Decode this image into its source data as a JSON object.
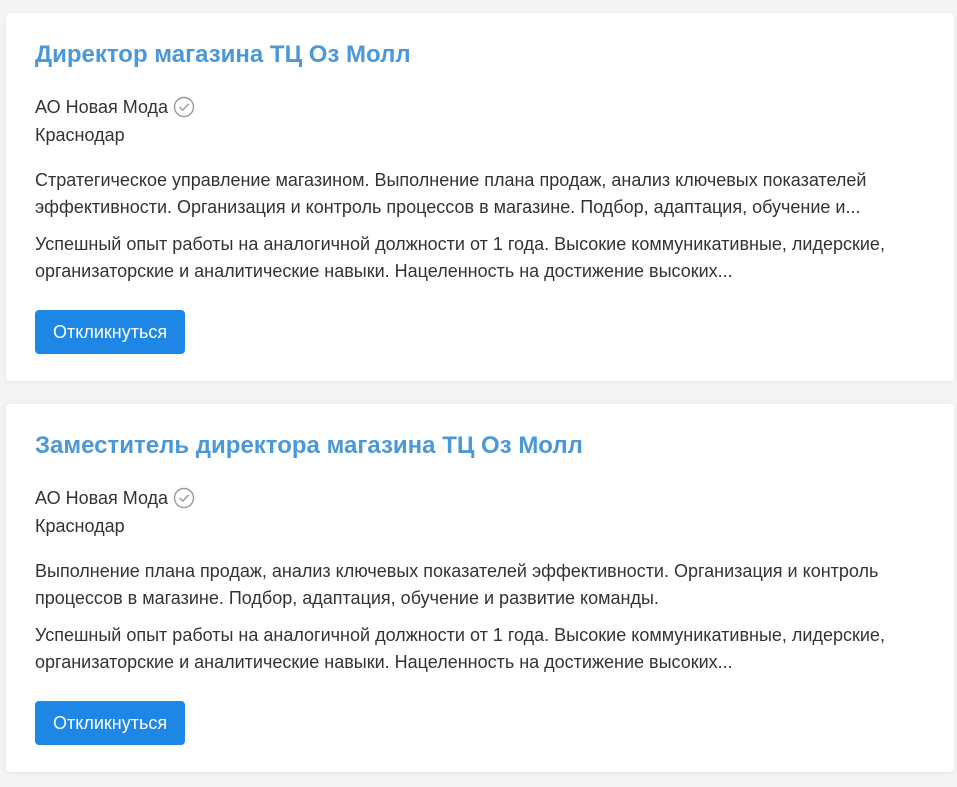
{
  "colors": {
    "title": "#4a98d8",
    "button": "#1e87e5",
    "text": "#333333",
    "verified_icon": "#9a9a9a"
  },
  "vacancies": [
    {
      "title": "Директор магазина ТЦ Оз Молл",
      "company": "АО Новая Мода",
      "company_icon": "verified-check-icon",
      "city": "Краснодар",
      "responsibilities": "Стратегическое управление магазином. Выполнение плана продаж, анализ ключевых показателей эффективности. Организация и контроль процессов в магазине. Подбор, адаптация, обучение и...",
      "requirements": "Успешный опыт работы на аналогичной должности от 1 года. Высокие коммуникативные, лидерские, организаторские и аналитические навыки. Нацеленность на достижение высоких...",
      "button_label": "Откликнуться"
    },
    {
      "title": "Заместитель директора магазина ТЦ Оз Молл",
      "company": "АО Новая Мода",
      "company_icon": "verified-check-icon",
      "city": "Краснодар",
      "responsibilities": "Выполнение плана продаж, анализ ключевых показателей эффективности. Организация и контроль процессов в магазине. Подбор, адаптация, обучение и развитие команды.",
      "requirements": "Успешный опыт работы на аналогичной должности от 1 года. Высокие коммуникативные, лидерские, организаторские и аналитические навыки. Нацеленность на достижение высоких...",
      "button_label": "Откликнуться"
    }
  ]
}
